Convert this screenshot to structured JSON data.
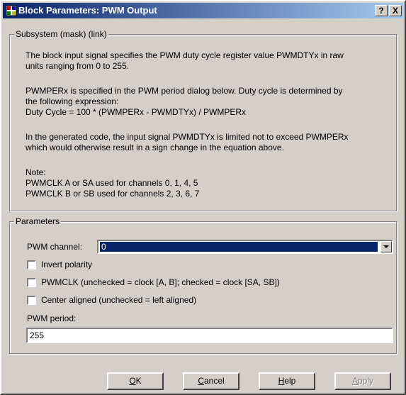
{
  "window": {
    "title": "Block Parameters: PWM Output",
    "help_label": "?",
    "close_label": "X"
  },
  "subsystem": {
    "legend": "Subsystem (mask) (link)",
    "lines": [
      "The block input signal specifies the PWM duty cycle register value PWMDTYx in raw",
      "units ranging from 0 to 255.",
      "PWMPERx is specified in the PWM period dialog below. Duty cycle is determined by",
      "the following expression:",
      "Duty Cycle = 100 * (PWMPERx - PWMDTYx) / PWMPERx",
      "In the generated code, the input signal PWMDTYx is limited not to exceed PWMPERx",
      "which would otherwise result in a sign change in the equation above.",
      "Note:",
      "PWMCLK A or SA used for channels 0, 1, 4, 5",
      "PWMCLK B or SB used for channels 2, 3, 6, 7"
    ]
  },
  "parameters": {
    "legend": "Parameters",
    "channel_label": "PWM channel:",
    "channel_value": "0",
    "invert_label": "Invert polarity",
    "invert_checked": false,
    "pwmclk_label": "PWMCLK  (unchecked = clock [A, B];  checked = clock [SA, SB])",
    "pwmclk_checked": false,
    "center_label": "Center aligned (unchecked = left aligned)",
    "center_checked": false,
    "period_label": "PWM period:",
    "period_value": "255"
  },
  "buttons": {
    "ok_mnemonic": "O",
    "ok_rest": "K",
    "cancel_mnemonic": "C",
    "cancel_rest": "ancel",
    "help_mnemonic": "H",
    "help_rest": "elp",
    "apply_mnemonic": "A",
    "apply_rest": "pply"
  },
  "colors": {
    "titlebar_start": "#0a246a",
    "titlebar_end": "#a6caf0",
    "face": "#d4d0c8",
    "selection": "#0a246a"
  }
}
